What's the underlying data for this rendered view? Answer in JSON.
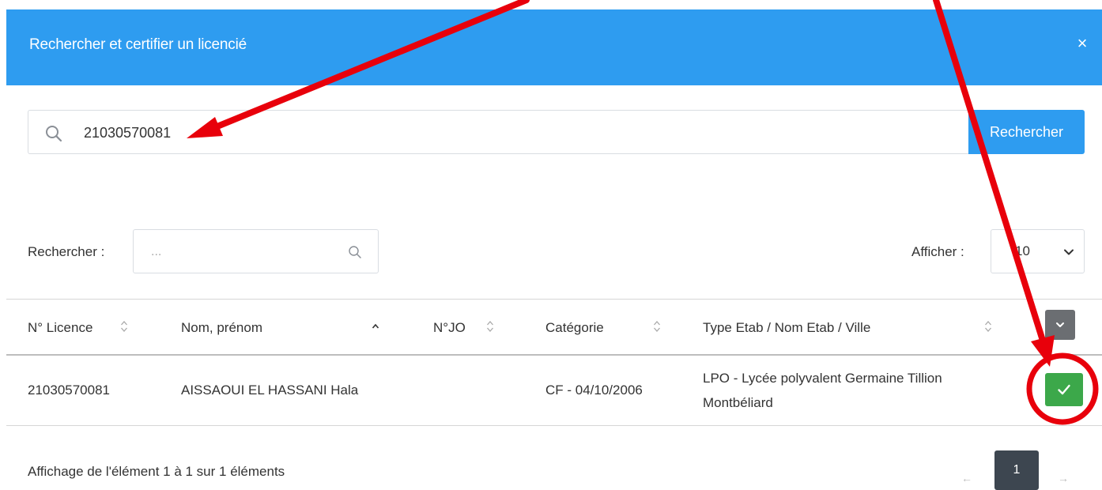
{
  "dialog": {
    "title": "Rechercher et certifier un licencié",
    "close_glyph": "×"
  },
  "search": {
    "value": "21030570081",
    "button_label": "Rechercher",
    "icon": "search-icon"
  },
  "filter": {
    "label": "Rechercher :",
    "placeholder": "...",
    "icon": "search-icon"
  },
  "page_size": {
    "label": "Afficher :",
    "selected": "10"
  },
  "table": {
    "columns": [
      {
        "label": "N° Licence",
        "sort": "none"
      },
      {
        "label": "Nom, prénom",
        "sort": "ascending"
      },
      {
        "label": "N°JO",
        "sort": "none"
      },
      {
        "label": "Catégorie",
        "sort": "none"
      },
      {
        "label": "Type Etab / Nom Etab / Ville",
        "sort": "none"
      }
    ],
    "rows": [
      {
        "licence": "21030570081",
        "name": "AISSAOUI EL HASSANI Hala",
        "jo": "",
        "category": "CF - 04/10/2006",
        "etab_line1": "LPO - Lycée polyvalent Germaine Tillion",
        "etab_line2": "Montbéliard"
      }
    ]
  },
  "footer": {
    "info": "Affichage de l'élément 1 à 1 sur 1 éléments",
    "prev_glyph": "←",
    "current_page": "1",
    "next_glyph": "→"
  },
  "colors": {
    "header": "#2e9cf0",
    "primary_button": "#2e9cf0",
    "certify_button": "#3ca84a",
    "column_menu_button": "#6b6e72",
    "active_page": "#3d4650",
    "annotation": "#e8000b"
  }
}
